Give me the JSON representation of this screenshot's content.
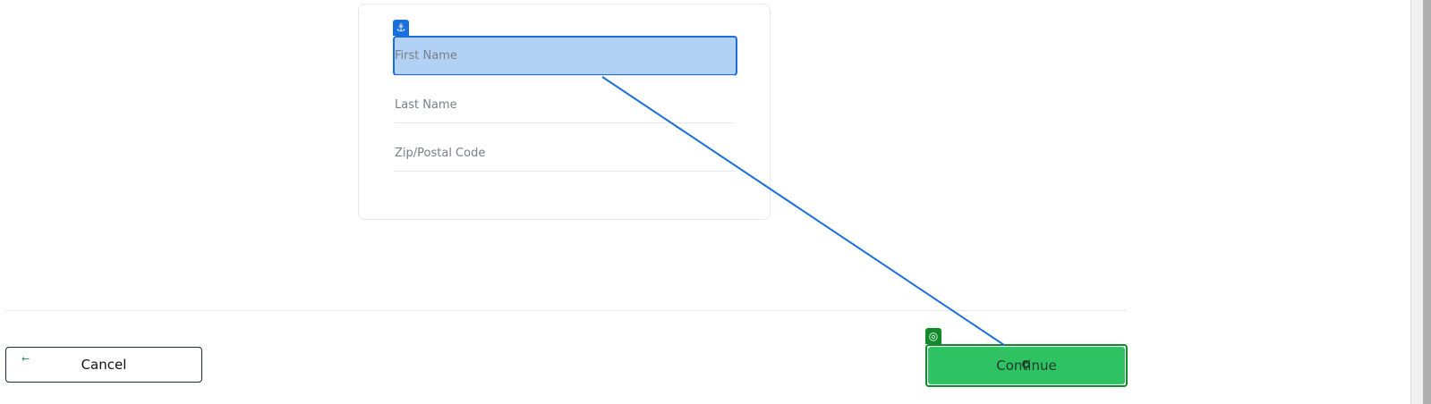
{
  "form": {
    "first_name_placeholder": "First Name",
    "last_name_placeholder": "Last Name",
    "zip_placeholder": "Zip/Postal Code"
  },
  "actions": {
    "cancel_label": "Cancel",
    "cancel_icon": "arrow-left-icon",
    "continue_label": "Continue"
  },
  "overlay": {
    "anchor_icon": "anchor-icon",
    "target_icon": "target-icon",
    "anchor_color": "#1a6fdc",
    "target_color": "#118a2c"
  },
  "colors": {
    "continue_bg": "#2ec262",
    "field_highlight": "#b3d1f5"
  }
}
